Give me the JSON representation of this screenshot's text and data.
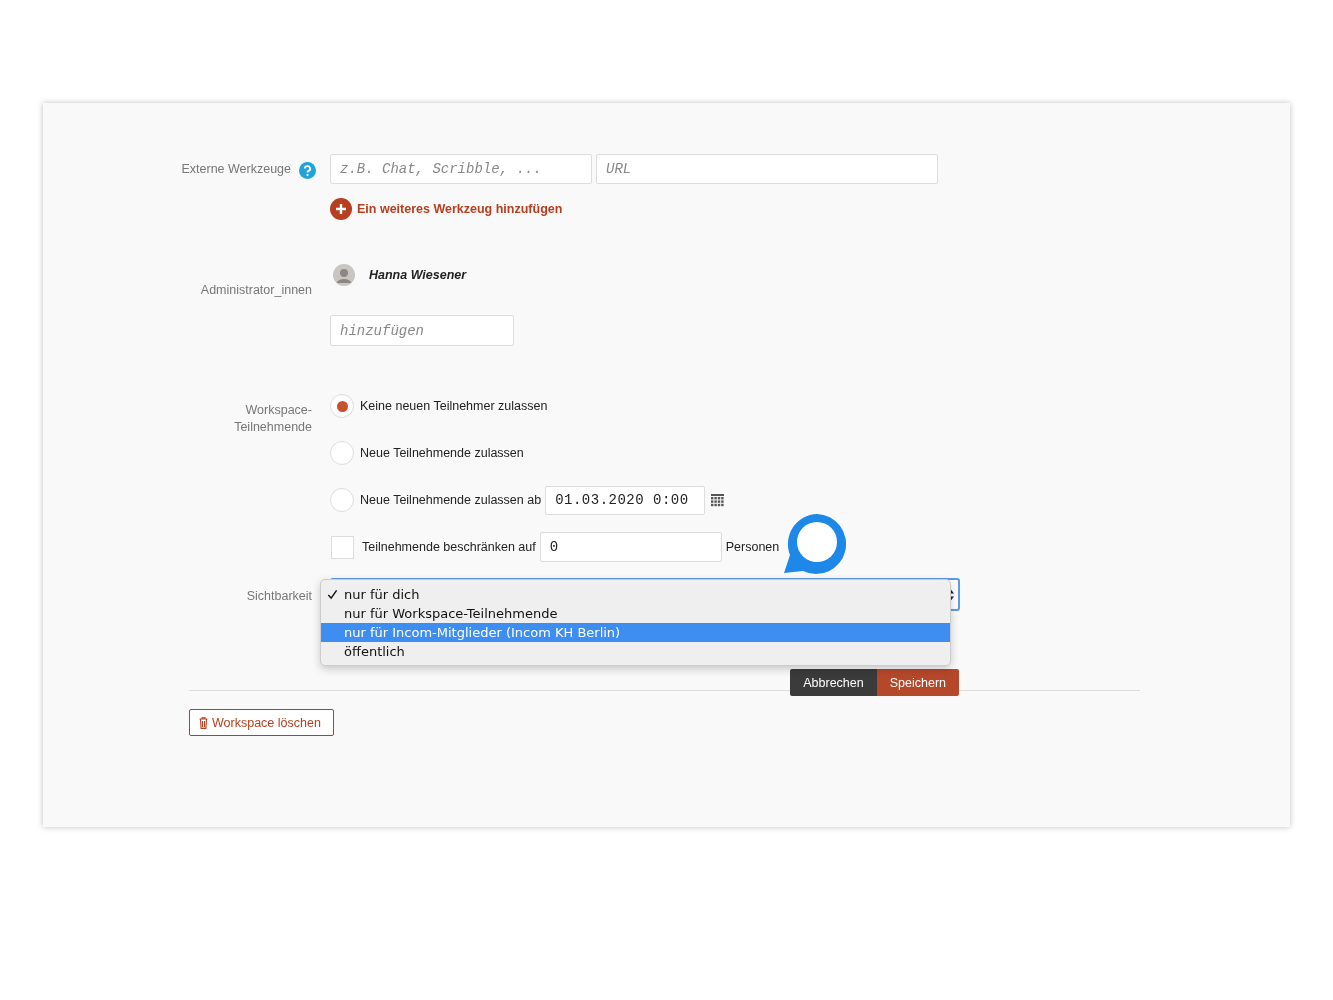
{
  "external_tools": {
    "label": "Externe Werkzeuge",
    "name_placeholder": "z.B. Chat, Scribble, ...",
    "url_placeholder": "URL",
    "add_link": "Ein weiteres Werkzeug hinzufügen"
  },
  "admins": {
    "label": "Administrator_innen",
    "people": [
      {
        "name": "Hanna Wiesener"
      }
    ],
    "add_placeholder": "hinzufügen"
  },
  "participants": {
    "label": "Workspace-Teilnehmende",
    "options": [
      {
        "kind": "radio",
        "label": "Keine neuen Teilnehmer zulassen",
        "selected": true
      },
      {
        "kind": "radio",
        "label": "Neue Teilnehmende zulassen",
        "selected": false
      },
      {
        "kind": "radio-date",
        "label": "Neue Teilnehmende zulassen ab",
        "selected": false,
        "value": "01.03.2020 0:00"
      },
      {
        "kind": "checkbox-number",
        "label": "Teilnehmende beschränken auf",
        "checked": false,
        "value": "0",
        "unit": "Personen"
      }
    ]
  },
  "visibility": {
    "label": "Sichtbarkeit",
    "options": [
      {
        "label": "nur für dich",
        "checked": true,
        "highlighted": false
      },
      {
        "label": "nur für Workspace-Teilnehmende",
        "checked": false,
        "highlighted": false
      },
      {
        "label": "nur für Incom-Mitglieder (Incom KH Berlin)",
        "checked": false,
        "highlighted": true
      },
      {
        "label": "öffentlich",
        "checked": false,
        "highlighted": false
      }
    ]
  },
  "buttons": {
    "cancel": "Abbrechen",
    "save": "Speichern"
  },
  "delete_button": "Workspace löschen"
}
